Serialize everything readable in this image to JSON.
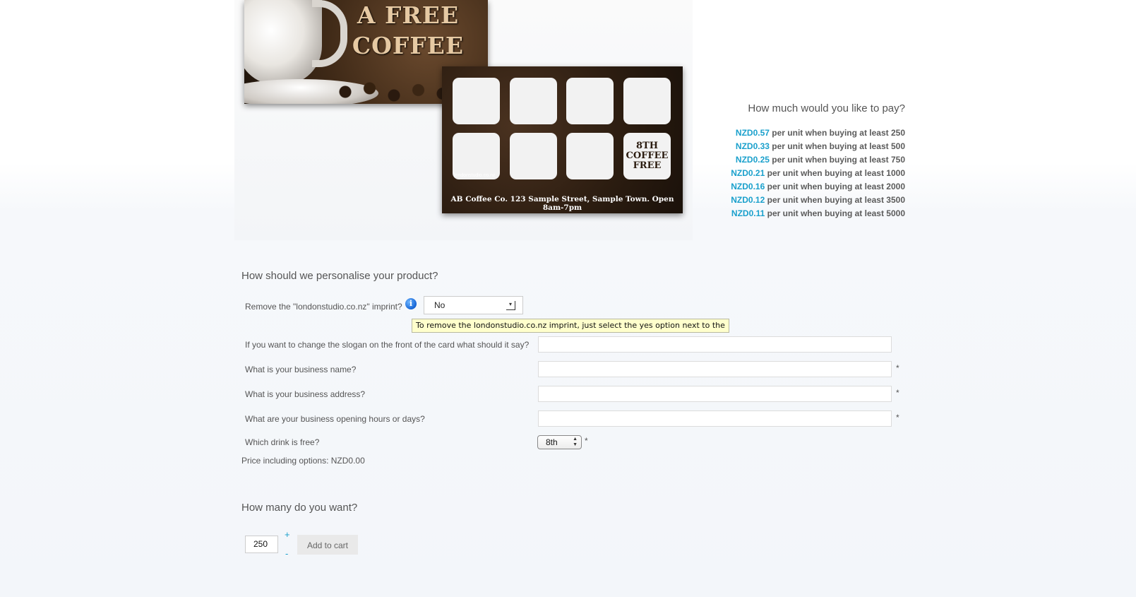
{
  "product_card": {
    "front_line1": "A FREE",
    "front_line2": "COFFEE",
    "free_stamp_lines": [
      "8TH",
      "COFFEE",
      "FREE"
    ],
    "mini_imprint": "londonstudio.co.nz",
    "back_footer": "AB Coffee Co. 123 Sample Street, Sample Town. Open 8am-7pm"
  },
  "pricing": {
    "title": "How much would you like to pay?",
    "rows": [
      {
        "amount": "NZD0.57",
        "text": " per unit when buying at least 250"
      },
      {
        "amount": "NZD0.33",
        "text": " per unit when buying at least 500"
      },
      {
        "amount": "NZD0.25",
        "text": " per unit when buying at least 750"
      },
      {
        "amount": "NZD0.21",
        "text": " per unit when buying at least 1000"
      },
      {
        "amount": "NZD0.16",
        "text": " per unit when buying at least 2000"
      },
      {
        "amount": "NZD0.12",
        "text": " per unit when buying at least 3500"
      },
      {
        "amount": "NZD0.11",
        "text": " per unit when buying at least 5000"
      }
    ],
    "amount_color": "#1aa0cc"
  },
  "personalise": {
    "heading": "How should we personalise your product?",
    "imprint_label": "Remove the \"londonstudio.co.nz\" imprint?",
    "imprint_value": "No",
    "info_icon": "info-icon",
    "tooltip": "To remove the londonstudio.co.nz imprint, just select the yes option next to the",
    "slogan_label": "If you want to change the slogan on the front of the card what should it say?",
    "business_name_label": "What is your business name?",
    "business_address_label": "What is your business address?",
    "opening_hours_label": "What are your business opening hours or days?",
    "required_mark": "*",
    "drink_label": "Which drink is free?",
    "drink_value": "8th",
    "price_including": "Price including options: NZD0.00"
  },
  "quantity": {
    "heading": "How many do you want?",
    "value": "250",
    "plus": "+",
    "minus": "-",
    "add_to_cart": "Add to cart"
  }
}
